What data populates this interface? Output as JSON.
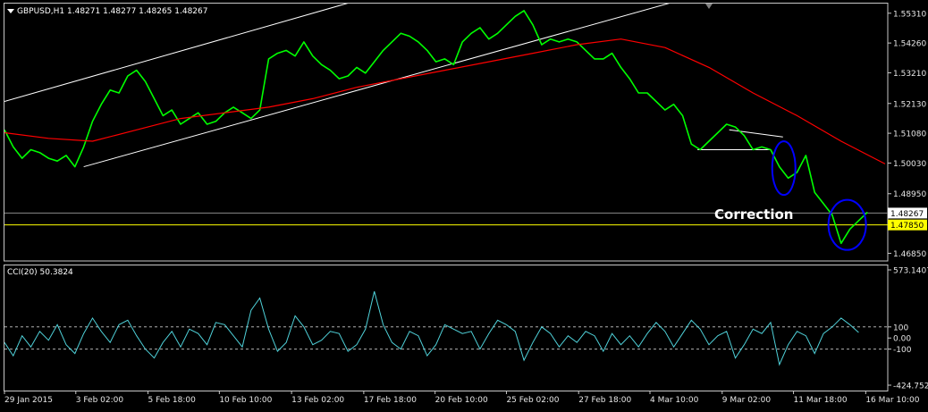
{
  "chart_data": [
    {
      "type": "line",
      "title": "GBPUSD,H1  1.48271 1.48277 1.48265 1.48267",
      "y_ticks": [
        1.5531,
        1.5426,
        1.5321,
        1.5213,
        1.5108,
        1.5003,
        1.4895,
        1.4685
      ],
      "y_tick_labels": [
        "1.55310",
        "1.54260",
        "1.53210",
        "1.52130",
        "1.51080",
        "1.50030",
        "1.48950",
        "1.46850"
      ],
      "ylim": [
        1.4658,
        1.5565
      ],
      "last_price": {
        "value": 1.48267,
        "label": "1.48267",
        "color": "#ffffff"
      },
      "level_line": {
        "value": 1.4785,
        "label": "1.47850",
        "color": "#ffff00"
      },
      "annotation": "Correction",
      "x_tick_labels": [
        "29 Jan 2015",
        "3 Feb 02:00",
        "5 Feb 18:00",
        "10 Feb 10:00",
        "13 Feb 02:00",
        "17 Feb 18:00",
        "20 Feb 10:00",
        "25 Feb 02:00",
        "27 Feb 18:00",
        "4 Mar 10:00",
        "9 Mar 02:00",
        "11 Mar 18:00",
        "16 Mar 10:00"
      ],
      "x_range": [
        0,
        100
      ],
      "x_ticks": [
        0,
        8.1,
        16.3,
        24.4,
        32.6,
        40.8,
        48.9,
        57.0,
        65.2,
        73.3,
        81.5,
        89.6,
        97.8
      ],
      "series": [
        {
          "color": "#00ff00",
          "x": [
            0,
            1,
            2,
            3,
            4,
            5,
            6,
            7,
            8,
            9,
            10,
            11,
            12,
            13,
            14,
            15,
            16,
            17,
            18,
            19,
            20,
            21,
            22,
            23,
            24,
            25,
            26,
            27,
            28,
            29,
            30,
            31,
            32,
            33,
            34,
            35,
            36,
            37,
            38,
            39,
            40,
            41,
            42,
            43,
            44,
            45,
            46,
            47,
            48,
            49,
            50,
            51,
            52,
            53,
            54,
            55,
            56,
            57,
            58,
            59,
            60,
            61,
            62,
            63,
            64,
            65,
            66,
            67,
            68,
            69,
            70,
            71,
            72,
            73,
            74,
            75,
            76,
            77,
            78,
            79,
            80,
            81,
            82,
            83,
            84,
            85,
            86,
            87,
            88,
            89,
            90,
            91,
            92,
            93,
            94,
            95,
            96,
            97,
            98
          ],
          "values": [
            1.512,
            1.506,
            1.502,
            1.505,
            1.504,
            1.502,
            1.501,
            1.503,
            1.499,
            1.506,
            1.515,
            1.521,
            1.526,
            1.525,
            1.531,
            1.533,
            1.529,
            1.523,
            1.517,
            1.519,
            1.514,
            1.516,
            1.518,
            1.514,
            1.515,
            1.518,
            1.52,
            1.518,
            1.516,
            1.519,
            1.537,
            1.539,
            1.54,
            1.538,
            1.543,
            1.538,
            1.535,
            1.533,
            1.53,
            1.531,
            1.534,
            1.532,
            1.536,
            1.54,
            1.543,
            1.546,
            1.545,
            1.543,
            1.54,
            1.536,
            1.537,
            1.535,
            1.543,
            1.546,
            1.548,
            1.544,
            1.546,
            1.549,
            1.552,
            1.554,
            1.549,
            1.542,
            1.544,
            1.543,
            1.544,
            1.543,
            1.54,
            1.537,
            1.537,
            1.539,
            1.534,
            1.53,
            1.525,
            1.525,
            1.522,
            1.519,
            1.521,
            1.517,
            1.507,
            1.505,
            1.508,
            1.511,
            1.514,
            1.513,
            1.51,
            1.505,
            1.506,
            1.505,
            1.499,
            1.495,
            1.497,
            1.503,
            1.49,
            1.486,
            1.482,
            1.472,
            1.477,
            1.48,
            1.483
          ]
        },
        {
          "color": "#ff0000",
          "x": [
            0,
            5,
            10,
            15,
            20,
            25,
            30,
            35,
            40,
            45,
            50,
            55,
            60,
            65,
            70,
            75,
            80,
            85,
            90,
            95,
            100
          ],
          "values": [
            1.511,
            1.509,
            1.508,
            1.512,
            1.516,
            1.518,
            1.52,
            1.523,
            1.527,
            1.53,
            1.533,
            1.536,
            1.539,
            1.542,
            1.544,
            1.541,
            1.534,
            1.525,
            1.517,
            1.508,
            1.5
          ]
        }
      ],
      "channel_lines": [
        {
          "color": "#ffffff",
          "x": [
            0,
            48.4
          ],
          "values": [
            1.522,
            1.565
          ]
        },
        {
          "color": "#ffffff",
          "x": [
            9,
            84
          ],
          "values": [
            1.499,
            1.564
          ]
        },
        {
          "color": "#ffffff",
          "x": [
            82.3,
            88.4
          ],
          "values": [
            1.512,
            1.5095
          ]
        },
        {
          "color": "#ffffff",
          "x": [
            78.7,
            87
          ],
          "values": [
            1.505,
            1.505
          ]
        }
      ],
      "ellipses": [
        {
          "color": "#0000ff",
          "cx": 88.5,
          "cy": 1.4985,
          "label": ""
        },
        {
          "color": "#0000ff",
          "cx": 95.7,
          "cy": 1.4785,
          "label": ""
        }
      ]
    },
    {
      "type": "line",
      "title": "CCI(20) 50.3824",
      "y_tick_labels": [
        "573.1407",
        "100",
        "0.00",
        "-100",
        "-424.7525"
      ],
      "y_ticks": [
        573.1407,
        100,
        0,
        -100,
        -424.7525
      ],
      "ylim": [
        -424.7525,
        573.1407
      ],
      "levels": [
        100,
        -100
      ],
      "series": [
        {
          "color": "#4fd1d9",
          "x": [
            0,
            1,
            2,
            3,
            4,
            5,
            6,
            7,
            8,
            9,
            10,
            11,
            12,
            13,
            14,
            15,
            16,
            17,
            18,
            19,
            20,
            21,
            22,
            23,
            24,
            25,
            26,
            27,
            28,
            29,
            30,
            31,
            32,
            33,
            34,
            35,
            36,
            37,
            38,
            39,
            40,
            41,
            42,
            43,
            44,
            45,
            46,
            47,
            48,
            49,
            50,
            51,
            52,
            53,
            54,
            55,
            56,
            57,
            58,
            59,
            60,
            61,
            62,
            63,
            64,
            65,
            66,
            67,
            68,
            69,
            70,
            71,
            72,
            73,
            74,
            75,
            76,
            77,
            78,
            79,
            80,
            81,
            82,
            83,
            84,
            85,
            86,
            87,
            88,
            89,
            90,
            91,
            92,
            93,
            94,
            95,
            96,
            97
          ],
          "values": [
            -40,
            -160,
            20,
            -80,
            60,
            -20,
            120,
            -60,
            -140,
            40,
            180,
            60,
            -40,
            120,
            160,
            20,
            -100,
            -180,
            -40,
            60,
            -80,
            80,
            40,
            -60,
            140,
            120,
            20,
            -80,
            250,
            360,
            80,
            -120,
            -40,
            200,
            100,
            -60,
            -20,
            60,
            40,
            -120,
            -60,
            80,
            420,
            120,
            -40,
            -100,
            60,
            20,
            -160,
            -60,
            120,
            80,
            40,
            60,
            -100,
            40,
            160,
            120,
            60,
            -200,
            -40,
            100,
            40,
            -80,
            20,
            -40,
            60,
            20,
            -120,
            40,
            -60,
            20,
            -80,
            40,
            140,
            60,
            -80,
            40,
            160,
            80,
            -60,
            20,
            60,
            -180,
            -60,
            80,
            40,
            140,
            -240,
            -60,
            60,
            20,
            -140,
            40,
            100,
            180,
            120,
            50
          ]
        }
      ]
    }
  ]
}
